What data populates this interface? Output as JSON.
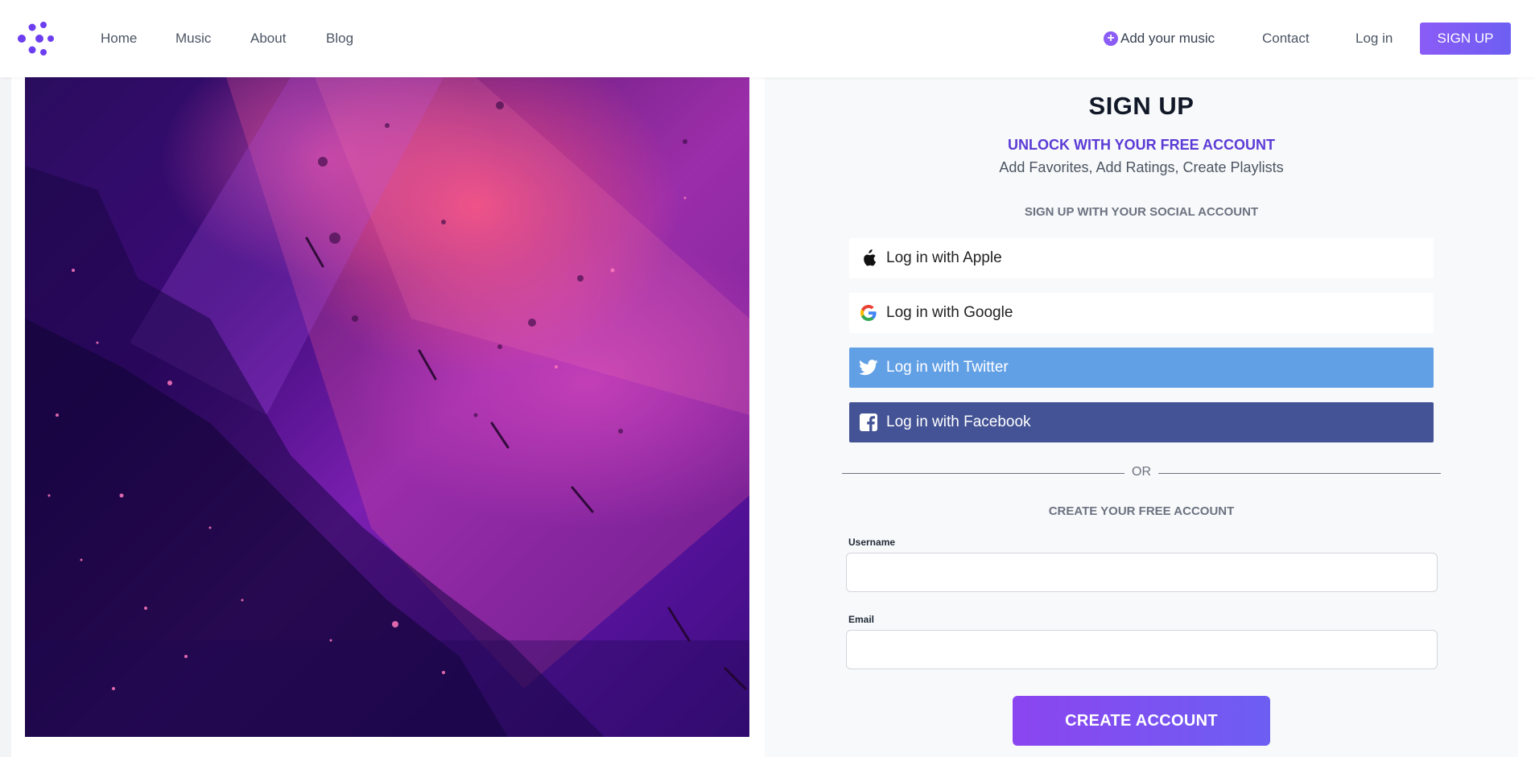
{
  "nav": {
    "home": "Home",
    "music": "Music",
    "about": "About",
    "blog": "Blog",
    "add_music": "Add your music",
    "contact": "Contact",
    "login": "Log in",
    "signup": "SIGN UP"
  },
  "form": {
    "title": "SIGN UP",
    "subtitle": "UNLOCK WITH YOUR FREE ACCOUNT",
    "perks": "Add Favorites, Add Ratings, Create Playlists",
    "social_heading": "SIGN UP WITH YOUR SOCIAL ACCOUNT",
    "apple": "Log in with Apple",
    "google": "Log in with Google",
    "twitter": "Log in with Twitter",
    "facebook": "Log in with Facebook",
    "or": "OR",
    "create_heading": "CREATE YOUR FREE ACCOUNT",
    "username_label": "Username",
    "email_label": "Email",
    "submit": "CREATE ACCOUNT"
  },
  "colors": {
    "accent": "#8b5cf6",
    "twitter": "#62a0e6",
    "facebook": "#435395"
  }
}
